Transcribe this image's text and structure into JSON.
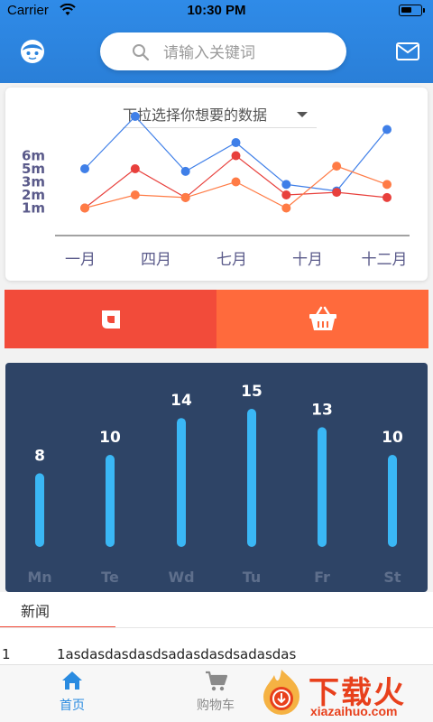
{
  "status": {
    "carrier": "Carrier",
    "time": "10:30 PM"
  },
  "search": {
    "placeholder": "请输入关键词"
  },
  "dropdown": {
    "label": "下拉选择你想要的数据"
  },
  "colors": {
    "header": "#2a82dc",
    "line_blue": "#3f7fe8",
    "line_red": "#e8403c",
    "line_orange": "#ff7b45",
    "bar": "#3ab7f5",
    "bar_bg": "#2e4466",
    "btn_left": "#f24b3a",
    "btn_right": "#ff6a3c"
  },
  "line_chart": {
    "type": "line",
    "y_tick_labels": [
      "1m",
      "2m",
      "3m",
      "5m",
      "6m"
    ],
    "x_tick_labels": [
      "一月",
      "四月",
      "七月",
      "十月",
      "十二月"
    ],
    "series": [
      {
        "color": "#3f7fe8",
        "values": [
          4,
          8,
          3.8,
          6,
          2.8,
          2.3,
          7
        ]
      },
      {
        "color": "#e8403c",
        "values": [
          1,
          4,
          1.8,
          5,
          2,
          2.2,
          1.8
        ]
      },
      {
        "color": "#ff7b45",
        "values": [
          1,
          2,
          1.8,
          3,
          1,
          4.2,
          2.8
        ]
      }
    ]
  },
  "chart_data": {
    "type": "bar",
    "categories": [
      "Mn",
      "Te",
      "Wd",
      "Tu",
      "Fr",
      "St"
    ],
    "values": [
      8,
      10,
      14,
      15,
      13,
      10
    ]
  },
  "icons": {
    "left_button": "chat-bubble-icon",
    "right_button": "basket-icon",
    "header_left": "face-icon",
    "header_right": "mail-icon"
  },
  "news": {
    "title": "新闻",
    "items": [
      {
        "index": "1",
        "text": "1asdasdasdasdsadasdasdsadasdas"
      }
    ]
  },
  "tabs": [
    {
      "label": "首页",
      "icon": "home-icon",
      "active": true
    },
    {
      "label": "购物车",
      "icon": "cart-icon",
      "active": false
    }
  ],
  "watermark": {
    "text": "下载火",
    "url": "xiazaihuo.com"
  }
}
